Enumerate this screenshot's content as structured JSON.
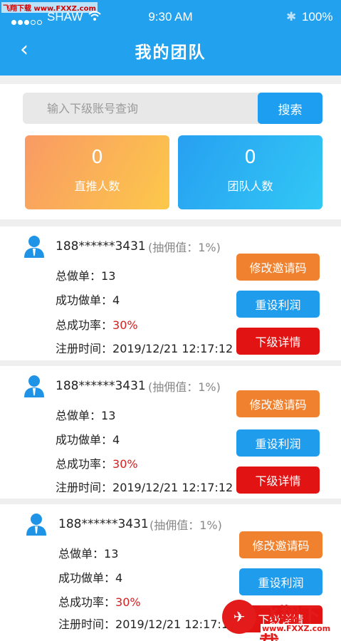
{
  "watermark_top": "飞翔下载 www.FXXZ.com",
  "status_bar": {
    "carrier": "SHAW",
    "time": "9:30 AM",
    "battery": "100%"
  },
  "header": {
    "title": "我的团队"
  },
  "search": {
    "placeholder": "输入下级账号查询",
    "button_label": "搜索"
  },
  "stats": [
    {
      "value": "0",
      "label": "直推人数",
      "color_start": "#f99a64",
      "color_end": "#fcc84a"
    },
    {
      "value": "0",
      "label": "团队人数",
      "color_start": "#27a0f1",
      "color_end": "#32c8f5"
    }
  ],
  "labels": {
    "total_orders": "总做单：",
    "success_orders": "成功做单：",
    "success_rate": "总成功率：",
    "register_time": "注册时间："
  },
  "members": [
    {
      "phone": "188******3431",
      "commission": "(抽佣值：1%)",
      "total_orders": "13",
      "success_orders": "4",
      "success_rate": "30%",
      "register_time": "2019/12/21  12:17:12",
      "buttons": [
        "修改邀请码",
        "重设利润",
        "下级详情"
      ]
    },
    {
      "phone": "188******3431",
      "commission": "(抽佣值：1%)",
      "total_orders": "13",
      "success_orders": "4",
      "success_rate": "30%",
      "register_time": "2019/12/21  12:17:12",
      "buttons": [
        "修改邀请码",
        "重设利润",
        "下级详情"
      ]
    },
    {
      "phone": "188******3431",
      "commission": "(抽佣值：1%)",
      "total_orders": "13",
      "success_orders": "4",
      "success_rate": "30%",
      "register_time": "2019/12/21  12:17:12",
      "buttons": [
        "修改邀请码",
        "重设利润",
        "下级详情"
      ]
    }
  ],
  "watermark_bottom": {
    "name": "飞翔下载",
    "url": "www.FXXZ.com"
  },
  "colors": {
    "primary": "#22a2ee",
    "orange_button": "#f0822f",
    "blue_button": "#1f9cec",
    "red_button": "#e21313",
    "rate_red": "#d81e1e"
  },
  "icons": [
    "back-arrow-icon",
    "wifi-icon",
    "bluetooth-icon",
    "user-avatar-icon"
  ]
}
